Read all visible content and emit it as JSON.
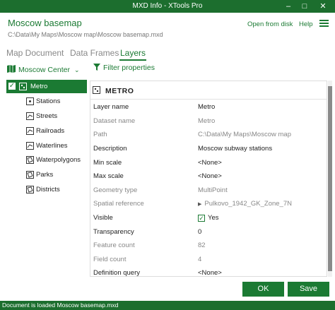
{
  "window": {
    "title": "MXD Info - XTools Pro"
  },
  "header": {
    "doc_name": "Moscow basemap",
    "doc_path": "C:\\Data\\My Maps\\Moscow map\\Moscow basemap.mxd",
    "open_from_disk": "Open from disk",
    "help": "Help"
  },
  "tabs": [
    "Map Document",
    "Data Frames",
    "Layers"
  ],
  "active_tab": "Layers",
  "dataframe": {
    "name": "Moscow Center"
  },
  "layers": [
    {
      "label": "Metro",
      "icon": "point-layer-icon",
      "checked": true,
      "selected": true
    },
    {
      "label": "Stations",
      "icon": "point-layer-icon"
    },
    {
      "label": "Streets",
      "icon": "line-layer-icon"
    },
    {
      "label": "Railroads",
      "icon": "line-layer-icon"
    },
    {
      "label": "Waterlines",
      "icon": "line-layer-icon"
    },
    {
      "label": "Waterpolygons",
      "icon": "polygon-layer-icon"
    },
    {
      "label": "Parks",
      "icon": "polygon-layer-icon"
    },
    {
      "label": "Districts",
      "icon": "polygon-layer-icon"
    }
  ],
  "filter": {
    "label": "Filter properties"
  },
  "details": {
    "title": "METRO",
    "properties": [
      {
        "key": "Layer name",
        "value": "Metro",
        "readonly": false
      },
      {
        "key": "Dataset name",
        "value": "Metro",
        "readonly": true
      },
      {
        "key": "Path",
        "value": "C:\\Data\\My Maps\\Moscow map",
        "readonly": true
      },
      {
        "key": "Description",
        "value": "Moscow subway stations",
        "readonly": false
      },
      {
        "key": "Min scale",
        "value": "<None>",
        "readonly": false
      },
      {
        "key": "Max scale",
        "value": "<None>",
        "readonly": false
      },
      {
        "key": "Geometry type",
        "value": "MultiPoint",
        "readonly": true
      },
      {
        "key": "Spatial reference",
        "value": "Pulkovo_1942_GK_Zone_7N",
        "readonly": true
      },
      {
        "key": "Visible",
        "value": "Yes",
        "readonly": false
      },
      {
        "key": "Transparency",
        "value": "0",
        "readonly": false
      },
      {
        "key": "Feature count",
        "value": "82",
        "readonly": true
      },
      {
        "key": "Field count",
        "value": "4",
        "readonly": true
      },
      {
        "key": "Definition query",
        "value": "<None>",
        "readonly": false
      }
    ]
  },
  "buttons": {
    "ok": "OK",
    "save": "Save"
  },
  "status": {
    "text": "Document is loaded Moscow basemap.mxd"
  },
  "colors": {
    "accent": "#1b7a33",
    "titlebar": "#1c6e2e"
  }
}
